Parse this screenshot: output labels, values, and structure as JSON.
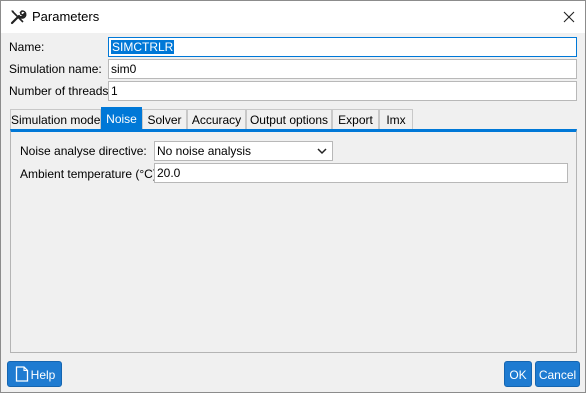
{
  "window": {
    "title": "Parameters"
  },
  "fields": {
    "name": {
      "label": "Name:",
      "value": "SIMCTRLR"
    },
    "sim_name": {
      "label": "Simulation name:",
      "value": "sim0"
    },
    "threads": {
      "label": "Number of threads:",
      "value": "1"
    }
  },
  "tabs": [
    {
      "label": "Simulation mode"
    },
    {
      "label": "Noise"
    },
    {
      "label": "Solver"
    },
    {
      "label": "Accuracy"
    },
    {
      "label": "Output options"
    },
    {
      "label": "Export"
    },
    {
      "label": "Imx"
    }
  ],
  "active_tab": "Noise",
  "noise": {
    "directive_label": "Noise analyse directive:",
    "directive_value": "No noise analysis",
    "ambient_label": "Ambient temperature (°C):",
    "ambient_value": "20.0"
  },
  "buttons": {
    "help": "Help",
    "ok": "OK",
    "cancel": "Cancel"
  },
  "colors": {
    "accent": "#0078d7",
    "button": "#1e7bd1"
  }
}
